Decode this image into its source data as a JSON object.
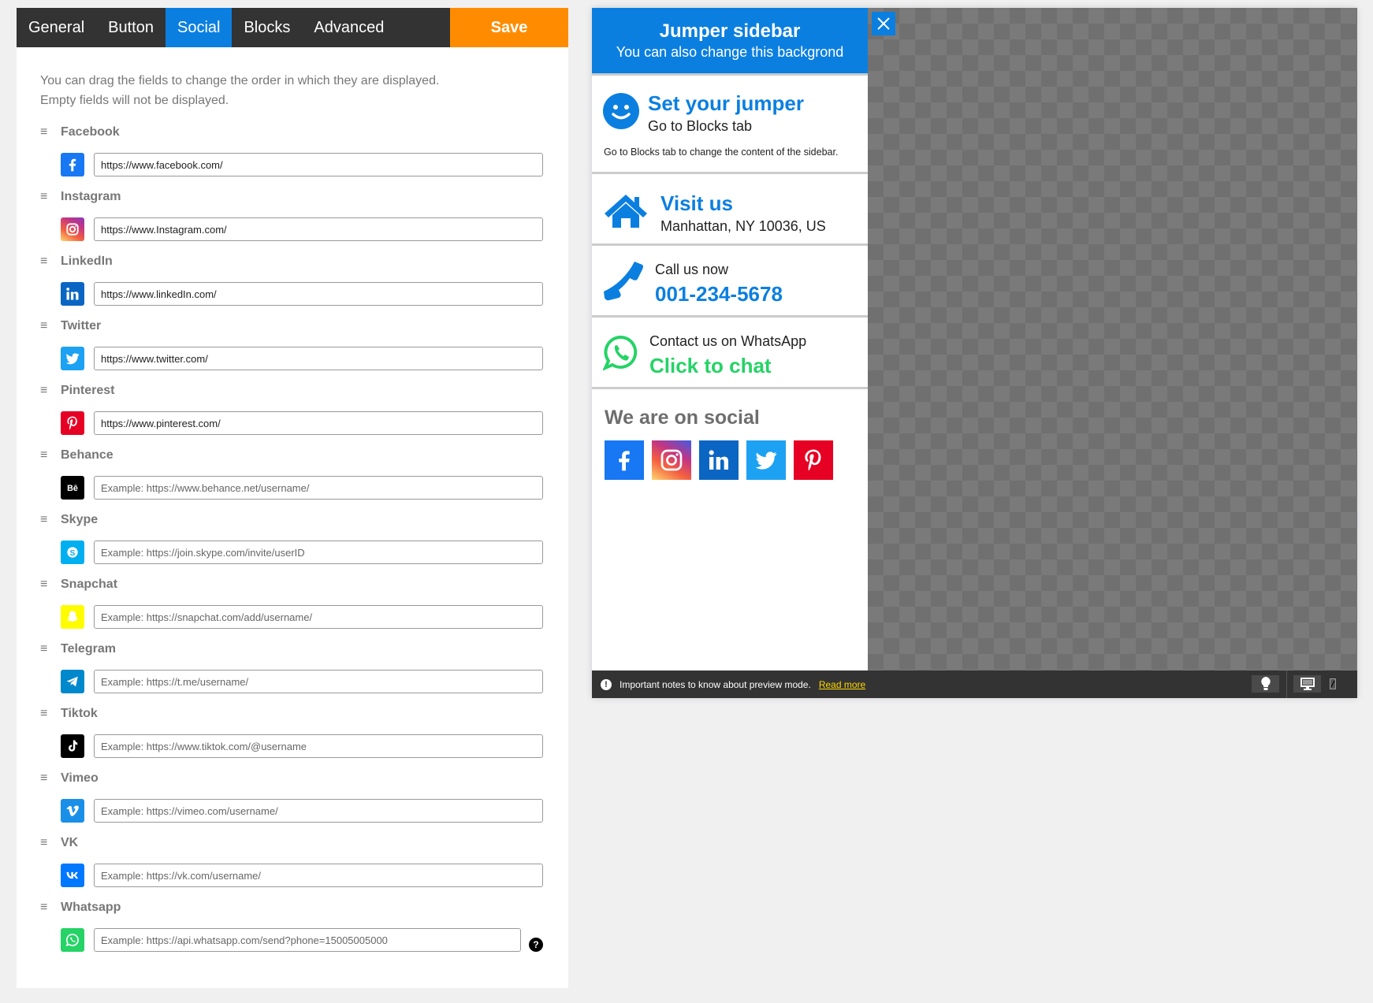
{
  "tabs": [
    {
      "label": "General",
      "active": false
    },
    {
      "label": "Button",
      "active": false
    },
    {
      "label": "Social",
      "active": true
    },
    {
      "label": "Blocks",
      "active": false
    },
    {
      "label": "Advanced",
      "active": false
    }
  ],
  "save_label": "Save",
  "intro": {
    "line1": "You can drag the fields to change the order in which they are displayed.",
    "line2": "Empty fields will not be displayed."
  },
  "fields": [
    {
      "label": "Facebook",
      "icon": "facebook-icon",
      "color": "#1877f2",
      "value": "https://www.facebook.com/",
      "placeholder": ""
    },
    {
      "label": "Instagram",
      "icon": "instagram-icon",
      "color": "#e1306c",
      "value": "https://www.Instagram.com/",
      "placeholder": ""
    },
    {
      "label": "LinkedIn",
      "icon": "linkedin-icon",
      "color": "#0a66c2",
      "value": "https://www.linkedIn.com/",
      "placeholder": ""
    },
    {
      "label": "Twitter",
      "icon": "twitter-icon",
      "color": "#1da1f2",
      "value": "https://www.twitter.com/",
      "placeholder": ""
    },
    {
      "label": "Pinterest",
      "icon": "pinterest-icon",
      "color": "#e60023",
      "value": "https://www.pinterest.com/",
      "placeholder": ""
    },
    {
      "label": "Behance",
      "icon": "behance-icon",
      "color": "#000000",
      "value": "",
      "placeholder": "Example: https://www.behance.net/username/"
    },
    {
      "label": "Skype",
      "icon": "skype-icon",
      "color": "#00aff0",
      "value": "",
      "placeholder": "Example: https://join.skype.com/invite/userID"
    },
    {
      "label": "Snapchat",
      "icon": "snapchat-icon",
      "color": "#fffc00",
      "value": "",
      "placeholder": "Example: https://snapchat.com/add/username/"
    },
    {
      "label": "Telegram",
      "icon": "telegram-icon",
      "color": "#0088cc",
      "value": "",
      "placeholder": "Example: https://t.me/username/"
    },
    {
      "label": "Tiktok",
      "icon": "tiktok-icon",
      "color": "#000000",
      "value": "",
      "placeholder": "Example: https://www.tiktok.com/@username"
    },
    {
      "label": "Vimeo",
      "icon": "vimeo-icon",
      "color": "#1a8fe8",
      "value": "",
      "placeholder": "Example: https://vimeo.com/username/"
    },
    {
      "label": "VK",
      "icon": "vk-icon",
      "color": "#0077ff",
      "value": "",
      "placeholder": "Example: https://vk.com/username/"
    },
    {
      "label": "Whatsapp",
      "icon": "whatsapp-icon",
      "color": "#25d366",
      "value": "",
      "placeholder": "Example: https://api.whatsapp.com/send?phone=15005005000",
      "help": "?"
    }
  ],
  "preview": {
    "header_title": "Jumper sidebar",
    "header_sub": "You can also change this backgrond",
    "block1": {
      "title": "Set your jumper",
      "subtitle": "Go to Blocks tab",
      "text": "Go to Blocks tab to change the content of the sidebar."
    },
    "block2": {
      "title": "Visit us",
      "subtitle": "Manhattan, NY 10036, US"
    },
    "block3": {
      "label": "Call us now",
      "phone": "001-234-5678"
    },
    "block4": {
      "label": "Contact us on WhatsApp",
      "cta": "Click to chat"
    },
    "social_title": "We are on social",
    "social_icons": [
      "facebook",
      "instagram",
      "linkedin",
      "twitter",
      "pinterest"
    ],
    "notice": "Important notes to know about preview mode.",
    "read_more": "Read more"
  },
  "colors": {
    "accent": "#0b7fe0",
    "save": "#ff8c00",
    "whatsapp": "#25d366",
    "dark": "#333333"
  }
}
